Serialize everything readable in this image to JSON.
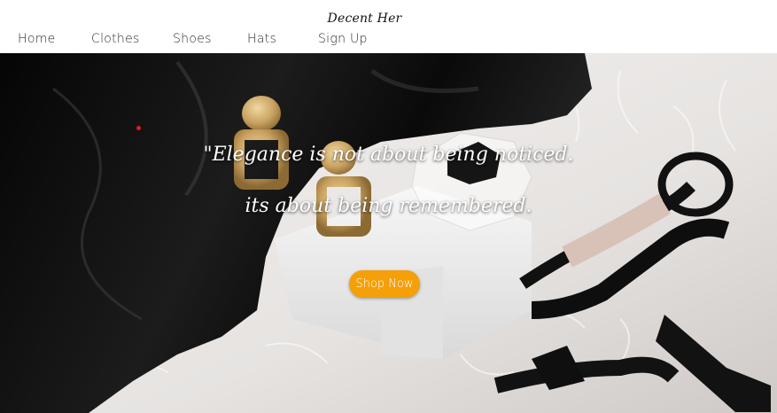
{
  "brand": {
    "name": "Decent Her"
  },
  "nav": {
    "items": [
      {
        "label": "Home"
      },
      {
        "label": "Clothes"
      },
      {
        "label": "Shoes"
      },
      {
        "label": "Hats"
      },
      {
        "label": "Sign Up"
      }
    ]
  },
  "hero": {
    "quote_line1": "\"Elegance is not about being noticed.",
    "quote_line2": "its about being remembered.",
    "cta_label": "Shop Now",
    "colors": {
      "cta": "#f5a009",
      "text": "#ffffff"
    }
  }
}
